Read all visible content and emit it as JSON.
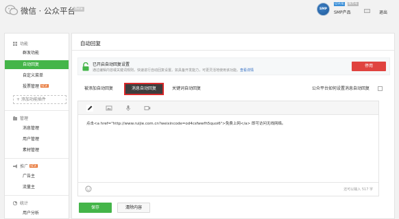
{
  "header": {
    "brand": "微信 · 公众平台",
    "beta": "Beta",
    "avatar_text": "SMP",
    "badge_verified": "已认证",
    "badge_service": "服务号",
    "account_name": "SMP产品",
    "logout": "退出"
  },
  "sidebar": {
    "sections": [
      {
        "title": "功能",
        "items": [
          "群发功能",
          "自动回复",
          "自定义菜单",
          "投票管理"
        ]
      },
      {
        "title": "管理",
        "items": [
          "消息管理",
          "用户管理",
          "素材管理"
        ]
      },
      {
        "title": "推广",
        "items": [
          "广告主",
          "流量主"
        ]
      },
      {
        "title": "统计",
        "items": [
          "用户分析"
        ]
      }
    ],
    "new_tag": "NEW",
    "add_plugin": "+ 添加功能插件"
  },
  "main": {
    "title": "自动回复",
    "notice": {
      "title": "已开启自动回复设置",
      "desc": "通过编辑内容或关键词规则，快速进行自动回复设置。如具备开发能力，可更灵活地使用该功能。",
      "link": "查看详情",
      "disable_button": "停用"
    },
    "tabs": [
      "被添加自动回复",
      "消息自动回复",
      "关键词自动回复"
    ],
    "tabs_right": "公众平台如何设置消息自动回复",
    "editor": {
      "content": "点击<a href=\"http://www.ruijie.com.cn?weixincode=od4csfwwfh5quoi6\">免费上网</a> 即可访问无线网络。",
      "counter": "还可以输入 517 字"
    },
    "save_button": "保存",
    "clear_button": "清除内容"
  },
  "colors": {
    "accent_green": "#44b549",
    "danger_red": "#e0433f",
    "link_blue": "#2f6bc2"
  }
}
